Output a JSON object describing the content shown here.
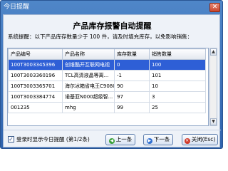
{
  "window": {
    "title": "今日提醒"
  },
  "dialog": {
    "heading": "产品库存报警自动提醒",
    "hint": "系统提醒：以下产品库存数量少于 100 件，请及时填充库存，以免影响销售："
  },
  "table": {
    "columns": [
      "产品编号",
      "产品名称",
      "库存数量",
      "销售数量"
    ],
    "rows": [
      [
        "100T3003345396",
        "创维酷开互联网电视",
        "0",
        "100"
      ],
      [
        "100T3003360196",
        "TCL高清液晶等离...",
        "-1",
        "101"
      ],
      [
        "100T3003365701",
        "海尔冰箱省电王C9080",
        "90",
        "10"
      ],
      [
        "100T3003384774",
        "诺基亚N000超级智...",
        "97",
        "3"
      ],
      [
        "001235",
        "mhg",
        "99",
        "25"
      ]
    ],
    "selected_row": 0
  },
  "footer": {
    "checkbox_label": "登录时显示今日提醒",
    "page_indicator": "(第1/2条)",
    "checked": true,
    "prev_label": "上一条",
    "next_label": "下一条",
    "close_label": "关闭(Esc)"
  },
  "icons": {
    "check": "check-icon",
    "prev": "arrow-left-icon",
    "next": "arrow-right-icon",
    "close": "close-icon"
  },
  "colors": {
    "titlebar": "#3a73bf",
    "selection": "#2e5fd6",
    "client_bg": "#eef2f8"
  }
}
